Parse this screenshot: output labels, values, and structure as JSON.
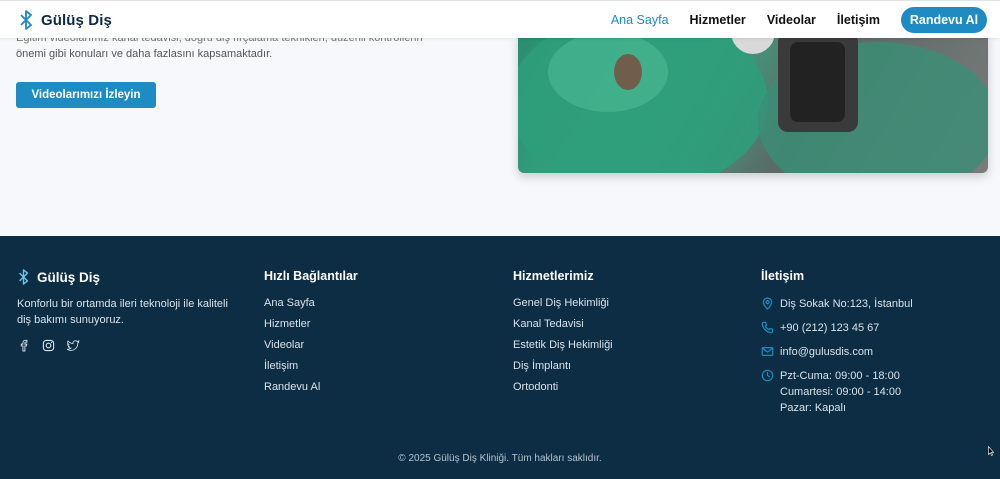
{
  "header": {
    "brand": "Gülüş Diş",
    "nav": [
      {
        "label": "Ana Sayfa",
        "active": true
      },
      {
        "label": "Hizmetler",
        "active": false
      },
      {
        "label": "Videolar",
        "active": false
      },
      {
        "label": "İletişim",
        "active": false
      }
    ],
    "cta": "Randevu Al"
  },
  "hero": {
    "text_line1": "Eğitim videolarımız kanal tedavisi, doğru diş fırçalama teknikleri, düzenli kontrollerin",
    "text_line2": "önemi gibi konuları ve daha fazlasını kapsamaktadır.",
    "button": "Videolarımızı İzleyin"
  },
  "footer": {
    "brand": "Gülüş Diş",
    "about": "Konforlu bir ortamda ileri teknoloji ile kaliteli diş bakımı sunuyoruz.",
    "socials": [
      "facebook-icon",
      "instagram-icon",
      "twitter-icon"
    ],
    "quick_links": {
      "title": "Hızlı Bağlantılar",
      "items": [
        "Ana Sayfa",
        "Hizmetler",
        "Videolar",
        "İletişim",
        "Randevu Al"
      ]
    },
    "services": {
      "title": "Hizmetlerimiz",
      "items": [
        "Genel Diş Hekimliği",
        "Kanal Tedavisi",
        "Estetik Diş Hekimliği",
        "Diş İmplantı",
        "Ortodonti"
      ]
    },
    "contact": {
      "title": "İletişim",
      "address": "Diş Sokak No:123, İstanbul",
      "phone": "+90 (212) 123 45 67",
      "email": "info@gulusdis.com",
      "hours_1": "Pzt-Cuma: 09:00 - 18:00",
      "hours_2": "Cumartesi: 09:00 - 14:00",
      "hours_3": "Pazar: Kapalı"
    },
    "copyright": "© 2025 Gülüş Diş Kliniği. Tüm hakları saklıdır."
  },
  "colors": {
    "accent": "#1e8bc3",
    "footer_bg": "#0d2d44"
  }
}
